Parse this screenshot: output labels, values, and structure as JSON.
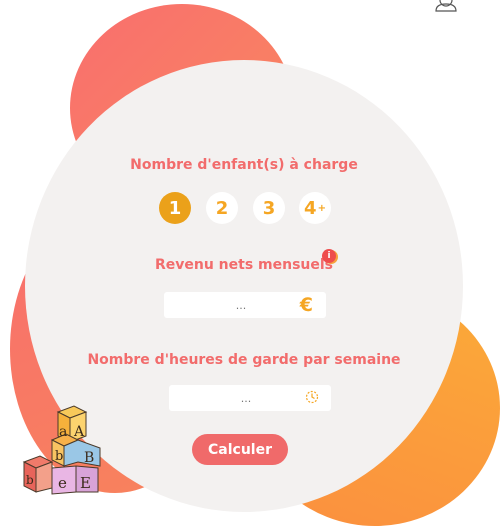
{
  "header": {
    "user_icon": "user-icon"
  },
  "form": {
    "children_label": "Nombre d'enfant(s) à charge",
    "children_options": [
      "1",
      "2",
      "3",
      "4"
    ],
    "children_plus": "+",
    "children_selected": "1",
    "income_label": "Revenu nets mensuels",
    "income_info_badge": "i",
    "income_placeholder": "...",
    "income_currency": "€",
    "hours_label": "Nombre d'heures de garde par semaine",
    "hours_placeholder": "...",
    "hours_icon": "clock-icon",
    "submit_label": "Calculer"
  },
  "illustration": {
    "icon": "alphabet-blocks-icon",
    "letters": [
      "a",
      "A",
      "b",
      "B",
      "b",
      "e",
      "E"
    ]
  },
  "colors": {
    "coral": "#f26c6c",
    "orange": "#f5a623",
    "panel": "#f3f1f0",
    "active_step": "#eba11a"
  }
}
